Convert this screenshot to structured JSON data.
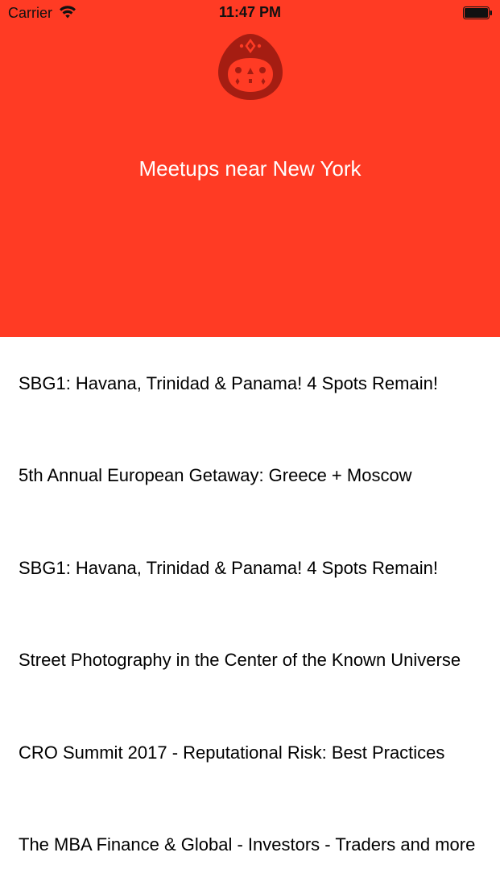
{
  "status_bar": {
    "carrier": "Carrier",
    "time": "11:47 PM",
    "wifi_icon": "wifi-icon",
    "battery_icon": "battery-icon"
  },
  "header": {
    "background_color": "#ff3b24",
    "logo_icon": "meetup-mascot-icon",
    "title": "Meetups near New York"
  },
  "meetups": [
    {
      "title": "SBG1: Havana, Trinidad & Panama! 4 Spots Remain!"
    },
    {
      "title": "5th Annual European Getaway: Greece + Moscow"
    },
    {
      "title": "SBG1: Havana, Trinidad & Panama! 4 Spots Remain!"
    },
    {
      "title": "Street Photography in the Center of the Known Universe"
    },
    {
      "title": "CRO Summit 2017 - Reputational Risk: Best Practices"
    },
    {
      "title": "The MBA Finance & Global - Investors - Traders and more"
    }
  ]
}
